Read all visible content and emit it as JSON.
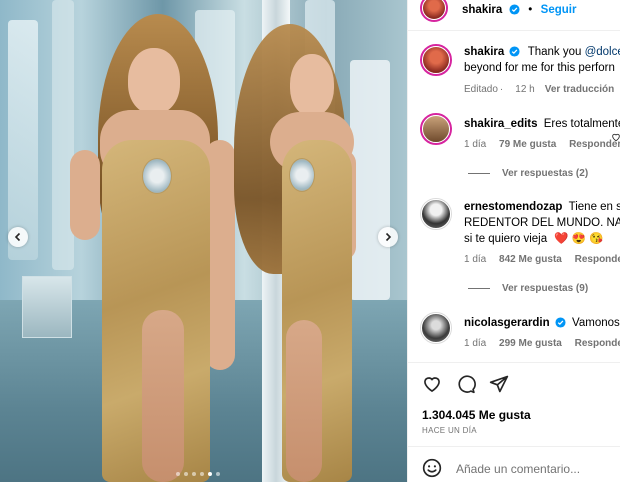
{
  "post_header": {
    "username": "shakira",
    "dot": "•",
    "follow_label": "Seguir"
  },
  "caption": {
    "username": "shakira",
    "text_prefix": "Thank you ",
    "mention": "@dolceg",
    "line2": "beyond for me for this perforn",
    "edited_label": "Editado",
    "time": "12 h",
    "translate_label": "Ver traducción"
  },
  "comments": [
    {
      "username": "shakira_edits",
      "text": "Eres totalmente",
      "time": "1 día",
      "likes": "79 Me gusta",
      "reply_label": "Responder",
      "view_replies": "Ver respuestas (2)"
    },
    {
      "username": "ernestomendozap",
      "text": "Tiene en su",
      "line2": "REDENTOR DEL MUNDO. NAD",
      "line3": "si te quiero vieja",
      "emoji": "❤️ 😍 😘",
      "time": "1 día",
      "likes": "842 Me gusta",
      "reply_label": "Responder",
      "view_replies": "Ver respuestas (9)"
    },
    {
      "username": "nicolasgerardin",
      "text": "Vamonosss",
      "time": "1 día",
      "likes": "299 Me gusta",
      "reply_label": "Responder"
    }
  ],
  "actions": {
    "likes_count": "1.304.045 Me gusta",
    "timestamp": "HACE UN DÍA"
  },
  "comment_box": {
    "placeholder": "Añade un comentario..."
  },
  "carousel": {
    "slide_count": 6,
    "active_index": 4
  },
  "colors": {
    "link": "#00376b",
    "follow": "#0095f6",
    "verified": "#0095f6",
    "heart": "#ed4956",
    "muted": "#737373"
  },
  "icons": [
    "chevron-left-icon",
    "chevron-right-icon",
    "verified-icon",
    "heart-icon",
    "comment-icon",
    "share-icon",
    "emoji-icon"
  ]
}
